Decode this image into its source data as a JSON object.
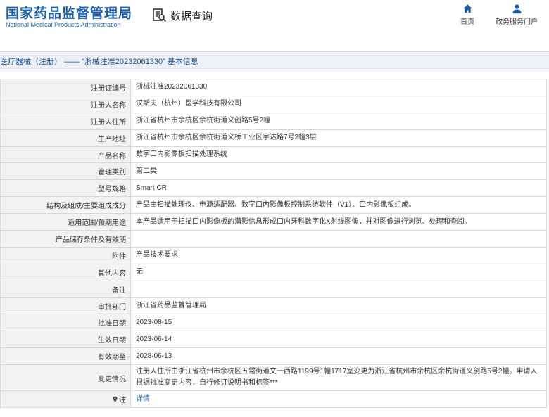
{
  "header": {
    "logo_cn": "国家药品监督管理局",
    "logo_en": "National Medical Products Administration",
    "query_label": "数据查询",
    "nav": [
      {
        "label": "首页",
        "icon": "home-icon"
      },
      {
        "label": "政务服务门户",
        "icon": "user-icon"
      }
    ]
  },
  "breadcrumb": "医疗器械（注册） —— “浙械注准20232061330” 基本信息",
  "rows": [
    {
      "label": "注册证编号",
      "value": "浙械注准20232061330"
    },
    {
      "label": "注册人名称",
      "value": "汉斯夫（杭州）医学科技有限公司"
    },
    {
      "label": "注册人住所",
      "value": "浙江省杭州市余杭区余杭街道义创路5号2幢"
    },
    {
      "label": "生产地址",
      "value": "浙江省杭州市余杭区余杭街道义桥工业区宇达路7号2幢3层"
    },
    {
      "label": "产品名称",
      "value": "数字口内影像板扫描处理系统"
    },
    {
      "label": "管理类别",
      "value": "第二类"
    },
    {
      "label": "型号规格",
      "value": "Smart CR"
    },
    {
      "label": "结构及组成/主要组成成分",
      "value": "产品由扫描处理仪、电源适配器、数字口内影像板控制系统软件（V1）、口内影像板组成。"
    },
    {
      "label": "适用范围/预期用途",
      "value": "本产品适用于扫描口内影像板的潜影信息形成口内牙科数字化X射线图像，并对图像进行浏览、处理和查阅。"
    },
    {
      "label": "产品储存条件及有效期",
      "value": ""
    },
    {
      "label": "附件",
      "value": "产品技术要求"
    },
    {
      "label": "其他内容",
      "value": "无"
    },
    {
      "label": "备注",
      "value": ""
    },
    {
      "label": "审批部门",
      "value": "浙江省药品监督管理局"
    },
    {
      "label": "批准日期",
      "value": "2023-08-15"
    },
    {
      "label": "生效日期",
      "value": "2023-06-14"
    },
    {
      "label": "有效期至",
      "value": "2028-06-13"
    },
    {
      "label": "变更情况",
      "value": "注册人住所由浙江省杭州市余杭区五常街道文一西路1199号1幢1717室变更为浙江省杭州市余杭区余杭街道义创路5号2幢。申请人根据批准变更内容，自行修订说明书和标签***"
    },
    {
      "label": "注",
      "value": "详情"
    }
  ],
  "colors": {
    "brand": "#1d5fa5",
    "label_bg": "#f2f2f2",
    "border": "#d9d9d9",
    "breadcrumb_bg": "#edf1f6"
  }
}
